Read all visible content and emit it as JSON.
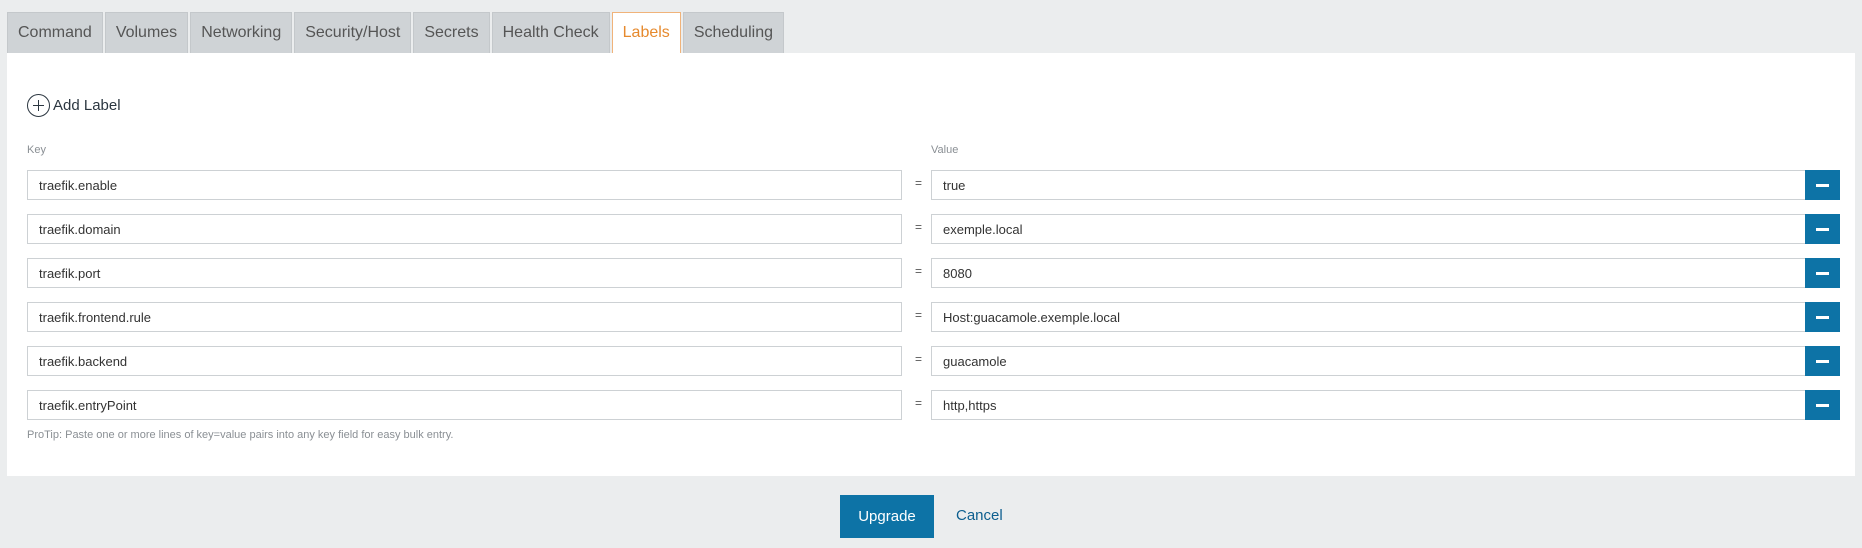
{
  "tabs": [
    {
      "label": "Command",
      "active": false
    },
    {
      "label": "Volumes",
      "active": false
    },
    {
      "label": "Networking",
      "active": false
    },
    {
      "label": "Security/Host",
      "active": false
    },
    {
      "label": "Secrets",
      "active": false
    },
    {
      "label": "Health Check",
      "active": false
    },
    {
      "label": "Labels",
      "active": true
    },
    {
      "label": "Scheduling",
      "active": false
    }
  ],
  "labels_panel": {
    "add_label": "Add Label",
    "key_header": "Key",
    "value_header": "Value",
    "separator": "=",
    "rows": [
      {
        "key": "traefik.enable",
        "value": "true"
      },
      {
        "key": "traefik.domain",
        "value": "exemple.local"
      },
      {
        "key": "traefik.port",
        "value": "8080"
      },
      {
        "key": "traefik.frontend.rule",
        "value": "Host:guacamole.exemple.local"
      },
      {
        "key": "traefik.backend",
        "value": "guacamole"
      },
      {
        "key": "traefik.entryPoint",
        "value": "http,https"
      }
    ],
    "protip": "ProTip: Paste one or more lines of key=value pairs into any key field for easy bulk entry."
  },
  "actions": {
    "upgrade_label": "Upgrade",
    "cancel_label": "Cancel"
  },
  "colors": {
    "accent": "#0d73a6",
    "active_tab_text": "#e68a2e",
    "background": "#ebedee"
  },
  "icons": {
    "add": "plus-circle-icon",
    "remove": "minus-icon"
  }
}
